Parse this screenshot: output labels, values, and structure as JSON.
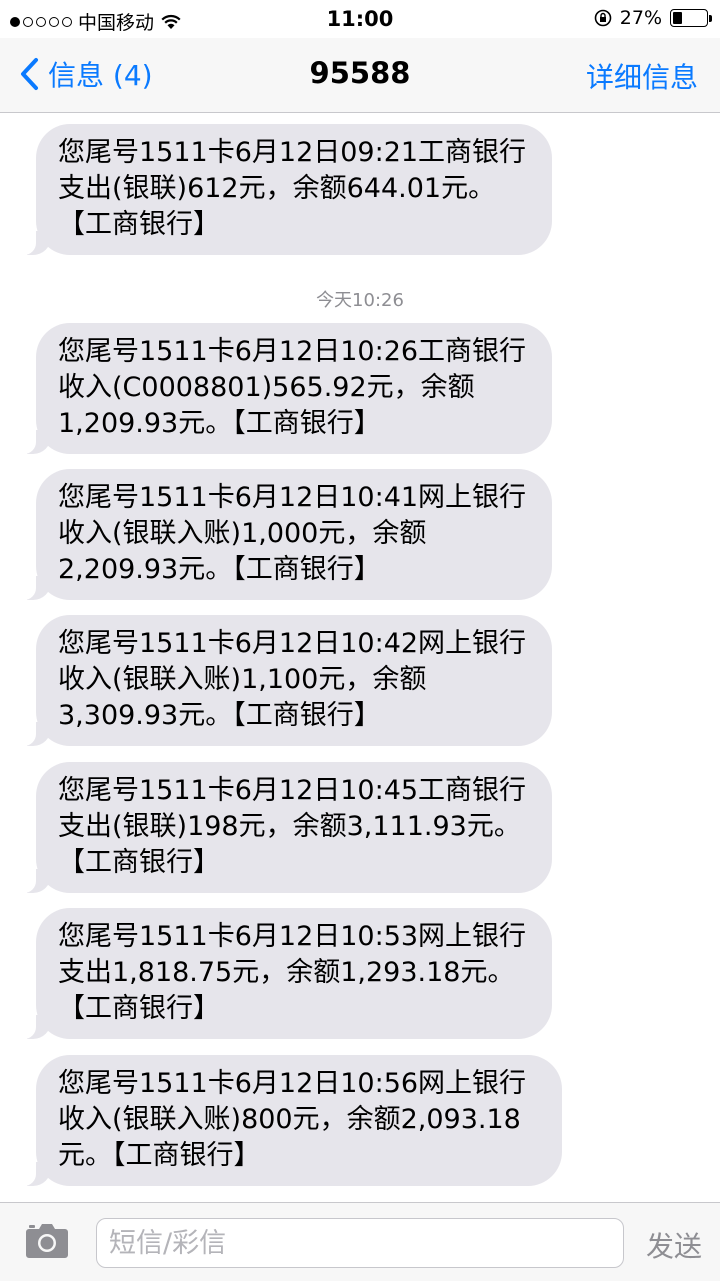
{
  "status_bar": {
    "carrier": "中国移动",
    "time": "11:00",
    "battery_percent": "27%",
    "battery_level": 0.27,
    "signal_bars_filled": 1,
    "signal_bars_total": 5
  },
  "nav": {
    "back_label": "信息 (4)",
    "title": "95588",
    "details_label": "详细信息",
    "accent_color": "#0a7aff"
  },
  "timestamp": "今天10:26",
  "messages": [
    {
      "lines": [
        "您尾号1511卡6月12日09:21工商银行",
        "支出(银联)612元，余额644.01元。",
        "【工商银行】"
      ]
    },
    {
      "lines": [
        "您尾号1511卡6月12日10:26工商银行",
        "收入(C0008801)565.92元，余额",
        "1,209.93元。【工商银行】"
      ]
    },
    {
      "lines": [
        "您尾号1511卡6月12日10:41网上银行",
        "收入(银联入账)1,000元，余额",
        "2,209.93元。【工商银行】"
      ]
    },
    {
      "lines": [
        "您尾号1511卡6月12日10:42网上银行",
        "收入(银联入账)1,100元，余额",
        "3,309.93元。【工商银行】"
      ]
    },
    {
      "lines": [
        "您尾号1511卡6月12日10:45工商银行",
        "支出(银联)198元，余额3,111.93元。",
        "【工商银行】"
      ]
    },
    {
      "lines": [
        "您尾号1511卡6月12日10:53网上银行",
        "支出1,818.75元，余额1,293.18元。",
        "【工商银行】"
      ]
    },
    {
      "lines": [
        "您尾号1511卡6月12日10:56网上银行",
        "收入(银联入账)800元，余额2,093.18",
        "元。【工商银行】"
      ]
    }
  ],
  "input_bar": {
    "placeholder": "短信/彩信",
    "send_label": "发送",
    "camera_icon": "camera-icon"
  }
}
